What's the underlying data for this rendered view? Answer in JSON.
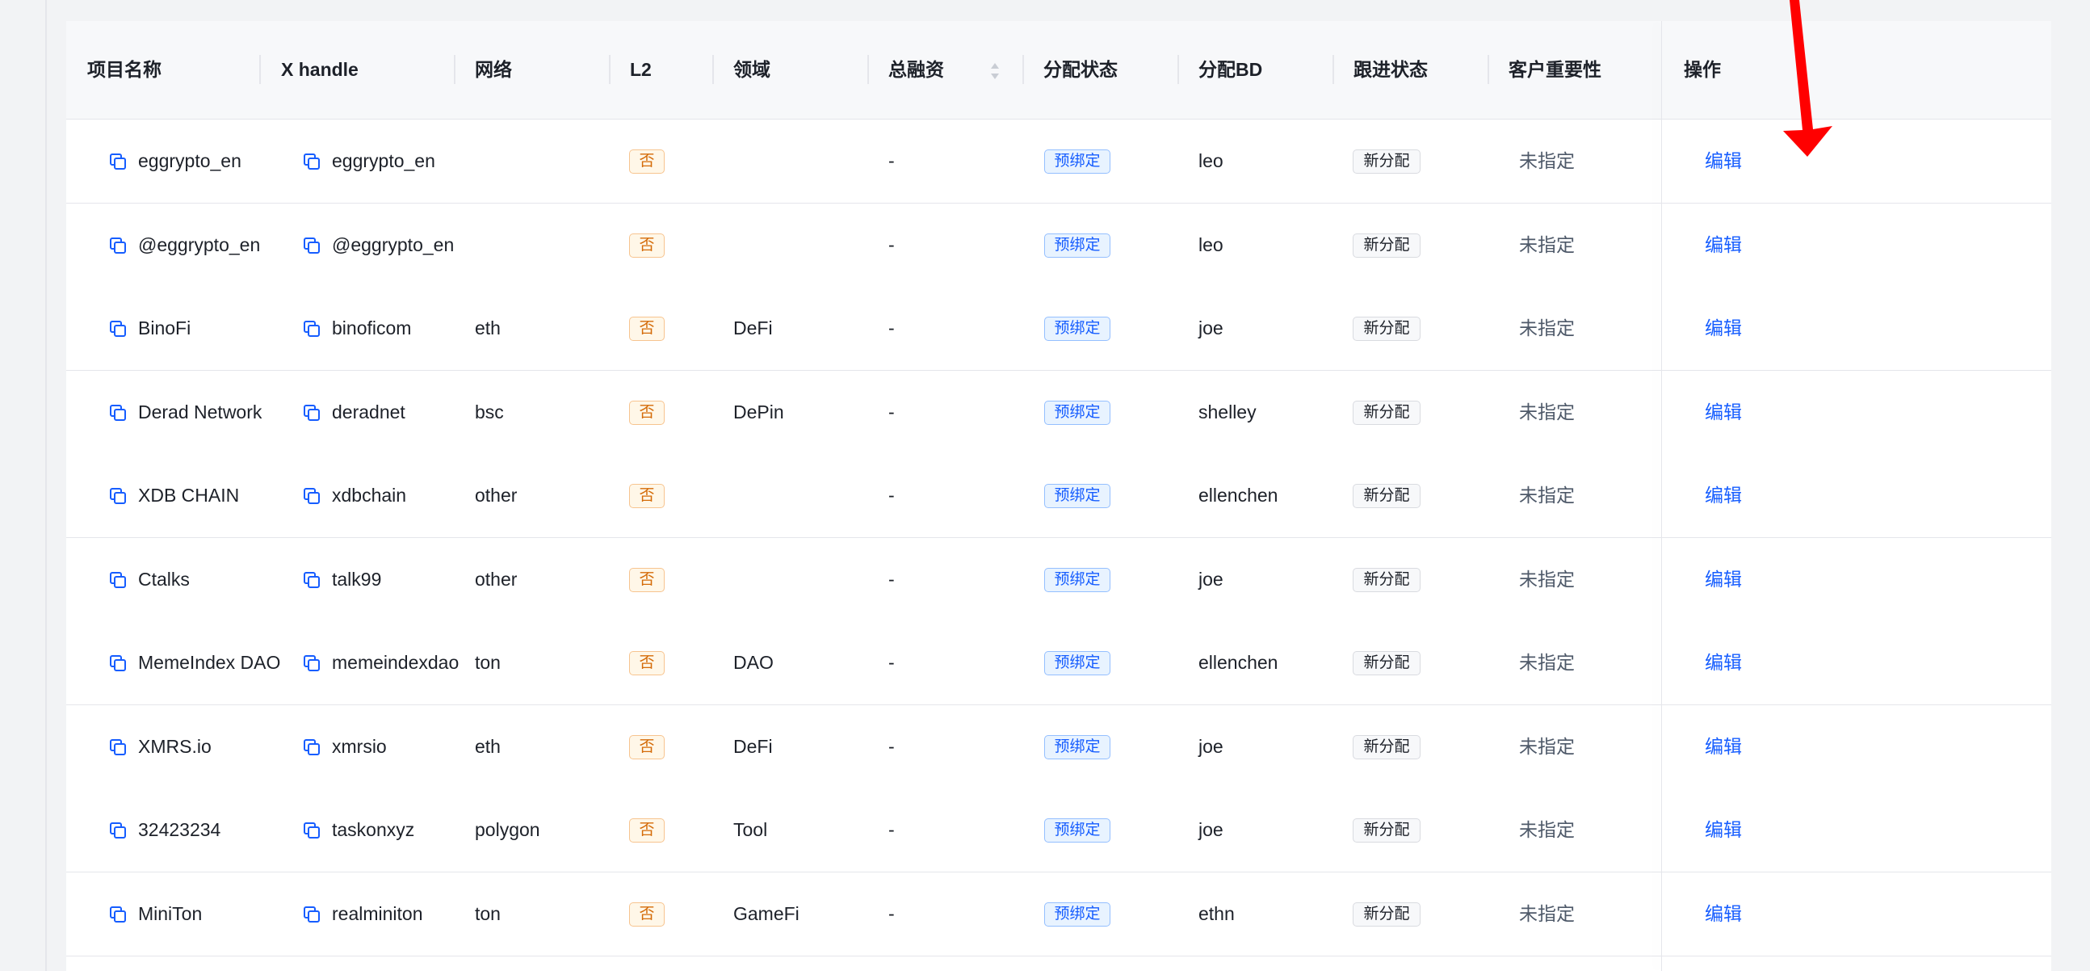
{
  "table": {
    "headers": {
      "name": "项目名称",
      "handle": "X handle",
      "network": "网络",
      "l2": "L2",
      "domain": "领域",
      "funding": "总融资",
      "assign_status": "分配状态",
      "assign_bd": "分配BD",
      "follow_status": "跟进状态",
      "importance": "客户重要性",
      "action": "操作"
    },
    "rows": [
      {
        "name": "eggrypto_en",
        "handle": "eggrypto_en",
        "network": "",
        "l2": "否",
        "domain": "",
        "funding": "-",
        "assign_status": "预绑定",
        "bd": "leo",
        "follow": "新分配",
        "importance": "未指定",
        "action": "编辑"
      },
      {
        "name": "@eggrypto_en",
        "handle": "@eggrypto_en",
        "network": "",
        "l2": "否",
        "domain": "",
        "funding": "-",
        "assign_status": "预绑定",
        "bd": "leo",
        "follow": "新分配",
        "importance": "未指定",
        "action": "编辑"
      },
      {
        "name": "BinoFi",
        "handle": "binoficom",
        "network": "eth",
        "l2": "否",
        "domain": "DeFi",
        "funding": "-",
        "assign_status": "预绑定",
        "bd": "joe",
        "follow": "新分配",
        "importance": "未指定",
        "action": "编辑"
      },
      {
        "name": "Derad Network",
        "handle": "deradnet",
        "network": "bsc",
        "l2": "否",
        "domain": "DePin",
        "funding": "-",
        "assign_status": "预绑定",
        "bd": "shelley",
        "follow": "新分配",
        "importance": "未指定",
        "action": "编辑"
      },
      {
        "name": "XDB CHAIN",
        "handle": "xdbchain",
        "network": "other",
        "l2": "否",
        "domain": "",
        "funding": "-",
        "assign_status": "预绑定",
        "bd": "ellenchen",
        "follow": "新分配",
        "importance": "未指定",
        "action": "编辑"
      },
      {
        "name": "Ctalks",
        "handle": "talk99",
        "network": "other",
        "l2": "否",
        "domain": "",
        "funding": "-",
        "assign_status": "预绑定",
        "bd": "joe",
        "follow": "新分配",
        "importance": "未指定",
        "action": "编辑"
      },
      {
        "name": "MemeIndex DAO",
        "handle": "memeindexdao",
        "network": "ton",
        "l2": "否",
        "domain": "DAO",
        "funding": "-",
        "assign_status": "预绑定",
        "bd": "ellenchen",
        "follow": "新分配",
        "importance": "未指定",
        "action": "编辑"
      },
      {
        "name": "XMRS.io",
        "handle": "xmrsio",
        "network": "eth",
        "l2": "否",
        "domain": "DeFi",
        "funding": "-",
        "assign_status": "预绑定",
        "bd": "joe",
        "follow": "新分配",
        "importance": "未指定",
        "action": "编辑"
      },
      {
        "name": "32423234",
        "handle": "taskonxyz",
        "network": "polygon",
        "l2": "否",
        "domain": "Tool",
        "funding": "-",
        "assign_status": "预绑定",
        "bd": "joe",
        "follow": "新分配",
        "importance": "未指定",
        "action": "编辑"
      },
      {
        "name": "MiniTon",
        "handle": "realminiton",
        "network": "ton",
        "l2": "否",
        "domain": "GameFi",
        "funding": "-",
        "assign_status": "预绑定",
        "bd": "ethn",
        "follow": "新分配",
        "importance": "未指定",
        "action": "编辑"
      }
    ]
  },
  "colors": {
    "primary": "#165dff",
    "warning_tag": "#d46b08",
    "annotation_arrow": "#ff0000"
  },
  "icons": {
    "copy": "copy-icon",
    "sort": "sort-icon",
    "annotation": "red-arrow-annotation"
  }
}
